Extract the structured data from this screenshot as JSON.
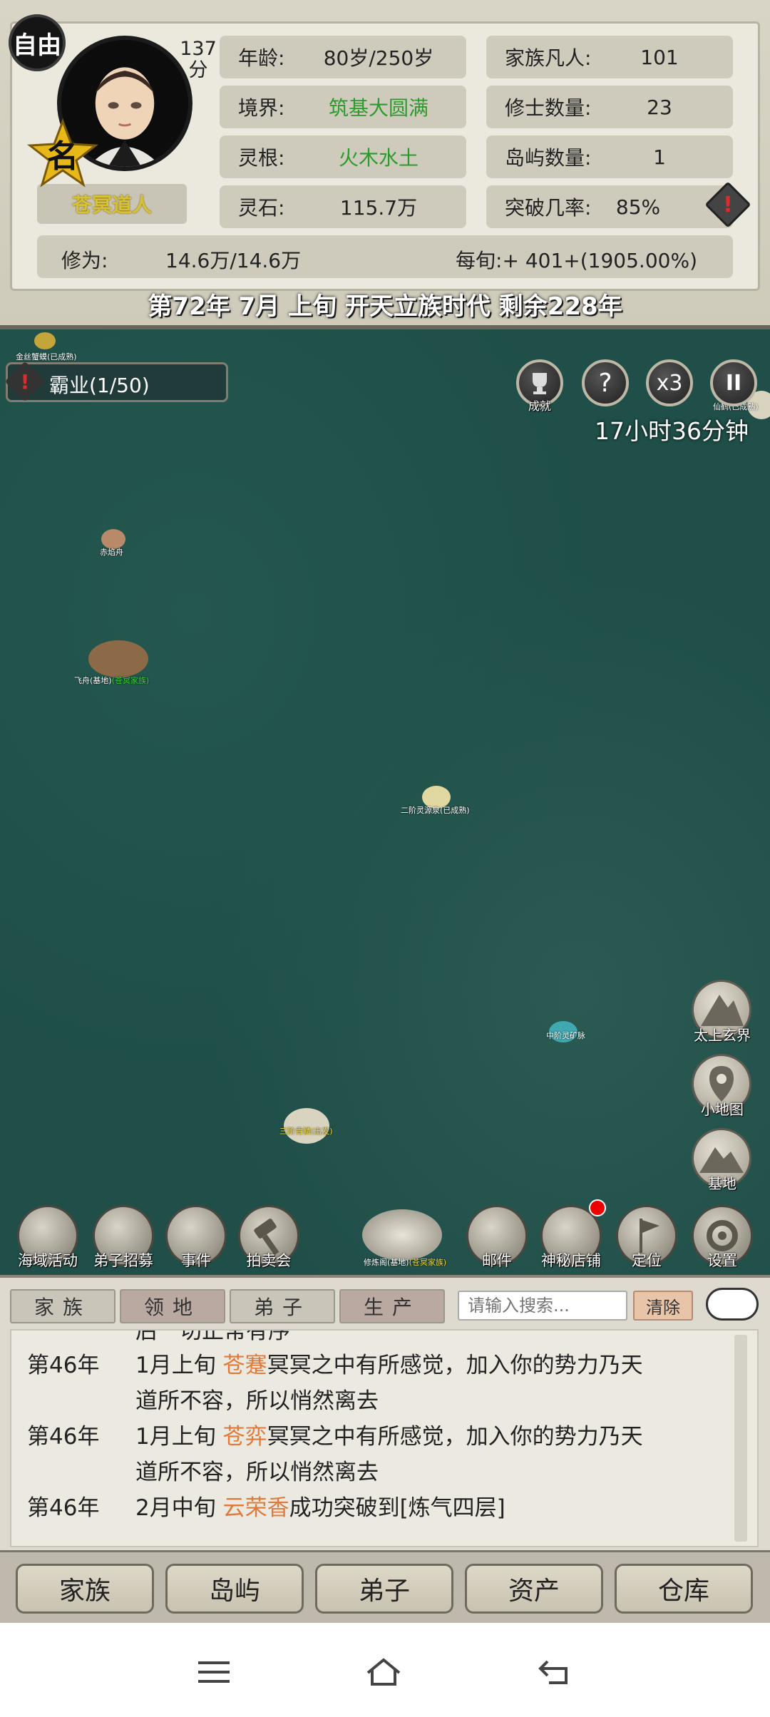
{
  "header": {
    "free_badge": "自由",
    "score": "137\n分",
    "rank_glyph": "名",
    "player_name": "苍冥道人",
    "stats": [
      {
        "label": "年龄:",
        "value": "80岁/250岁"
      },
      {
        "label": "家族凡人:",
        "value": "101"
      },
      {
        "label": "境界:",
        "value": "筑基大圆满"
      },
      {
        "label": "修士数量:",
        "value": "23"
      },
      {
        "label": "灵根:",
        "value": "火木水土"
      },
      {
        "label": "岛屿数量:",
        "value": "1"
      },
      {
        "label": "灵石:",
        "value": "115.7万"
      },
      {
        "label": "突破几率:",
        "value": "85%"
      }
    ],
    "cultivation_label": "修为:",
    "cultivation_value": "14.6万/14.6万",
    "per_period": "每旬:+ 401+(1905.00%)",
    "warning_glyph": "!",
    "date_line": "第72年 7月 上旬  开天立族时代 剩余228年"
  },
  "map": {
    "quest_label": "霸业(1/50)",
    "quest_icon": "!",
    "timer": "17小时36分钟",
    "achievements_label": "成就",
    "help_glyph": "?",
    "speed_glyph": "x3",
    "pause_glyph": "II",
    "labels": {
      "gold_beast": "金丝蟹蟆(已成熟)",
      "ship1": "赤焰舟",
      "ship2_a": "飞舟(基地)",
      "ship2_b": "(苍冥家族)",
      "island_center": "二阶灵源泉(已成熟)",
      "island_right": "中阶灵矿脉",
      "creature": "三阶青鳞(出发)",
      "home_base_a": "修炼阁(基地)",
      "home_base_b": "(苍冥家族)",
      "edge_right": "仙鹤(已成熟)"
    },
    "side_buttons": [
      {
        "label": "太上玄界"
      },
      {
        "label": "小地图"
      },
      {
        "label": "基地"
      }
    ],
    "bottom_buttons": [
      {
        "label": "海域活动"
      },
      {
        "label": "弟子招募"
      },
      {
        "label": "事件"
      },
      {
        "label": "拍卖会"
      },
      {
        "label": "邮件"
      },
      {
        "label": "神秘店铺"
      },
      {
        "label": "定位"
      },
      {
        "label": "设置"
      }
    ]
  },
  "log": {
    "tabs": [
      "家族",
      "领地",
      "弟子",
      "生产"
    ],
    "search_placeholder": "请输入搜索...",
    "clear_label": "清除",
    "cut_top": "后一切正常有序",
    "rows": [
      {
        "year": "第46年",
        "pre": "1月上旬 ",
        "name": "苍蹇",
        "post": "冥冥之中有所感觉，加入你的势力乃天"
      },
      {
        "year": "",
        "pre": "道所不容，所以悄然离去",
        "name": "",
        "post": ""
      },
      {
        "year": "第46年",
        "pre": "1月上旬 ",
        "name": "苍弈",
        "post": "冥冥之中有所感觉，加入你的势力乃天"
      },
      {
        "year": "",
        "pre": "道所不容，所以悄然离去",
        "name": "",
        "post": ""
      },
      {
        "year": "第46年",
        "pre": "2月中旬 ",
        "name": "云荣香",
        "post": "成功突破到[炼气四层]"
      }
    ]
  },
  "nav": [
    "家族",
    "岛屿",
    "弟子",
    "资产",
    "仓库"
  ],
  "system_bar": {
    "menu_icon": "menu-icon",
    "home_icon": "home-icon",
    "back_icon": "back-icon"
  }
}
